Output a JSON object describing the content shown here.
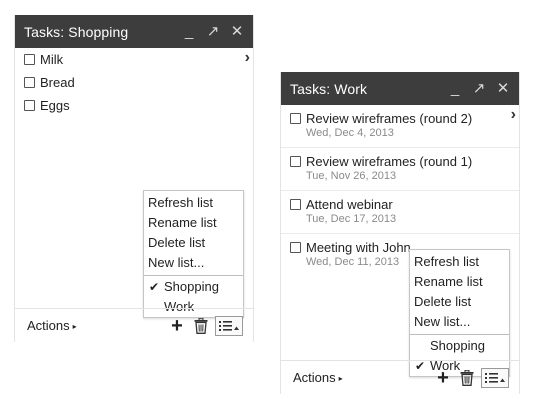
{
  "shopping": {
    "title": "Tasks: Shopping",
    "tasks": [
      {
        "title": "Milk"
      },
      {
        "title": "Bread"
      },
      {
        "title": "Eggs"
      }
    ],
    "menu": {
      "actions": [
        "Refresh list",
        "Rename list",
        "Delete list",
        "New list..."
      ],
      "lists": [
        {
          "label": "Shopping",
          "checked": true
        },
        {
          "label": "Work",
          "checked": false
        }
      ]
    },
    "footer": {
      "actions_label": "Actions"
    }
  },
  "work": {
    "title": "Tasks: Work",
    "tasks": [
      {
        "title": "Review wireframes (round 2)",
        "date": "Wed, Dec 4, 2013"
      },
      {
        "title": "Review wireframes (round 1)",
        "date": "Tue, Nov 26, 2013"
      },
      {
        "title": "Attend webinar",
        "date": "Tue, Dec 17, 2013"
      },
      {
        "title": "Meeting with John",
        "date": "Wed, Dec 11, 2013"
      }
    ],
    "menu": {
      "actions": [
        "Refresh list",
        "Rename list",
        "Delete list",
        "New list..."
      ],
      "lists": [
        {
          "label": "Shopping",
          "checked": false
        },
        {
          "label": "Work",
          "checked": true
        }
      ]
    },
    "footer": {
      "actions_label": "Actions"
    }
  },
  "glyphs": {
    "check": "✔",
    "chevron": "›",
    "dropdown": "▸",
    "minimize": "_",
    "maximize": "↗",
    "close": "✕",
    "add": "+"
  },
  "colors": {
    "titlebar": "#3d3d3d",
    "titlebar_text": "#ffffff",
    "date_text": "#8a8a8a"
  },
  "icons": [
    "minimize-icon",
    "maximize-icon",
    "close-icon",
    "chevron-right-icon",
    "plus-icon",
    "trash-icon",
    "list-menu-icon"
  ]
}
